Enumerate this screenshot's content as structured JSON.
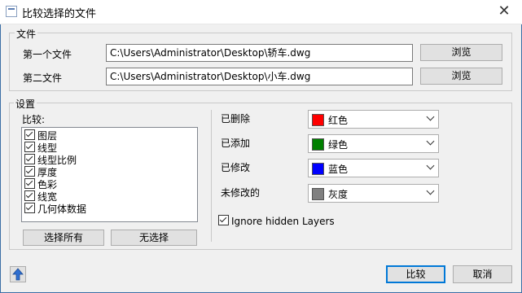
{
  "window": {
    "title": "比较选择的文件",
    "close_glyph": "✕"
  },
  "files": {
    "group_label": "文件",
    "first": {
      "label": "第一个文件",
      "value": "C:\\Users\\Administrator\\Desktop\\轿车.dwg",
      "browse_label": "浏览"
    },
    "second": {
      "label": "第二文件",
      "value": "C:\\Users\\Administrator\\Desktop\\小车.dwg",
      "browse_label": "浏览"
    }
  },
  "settings": {
    "group_label": "设置",
    "compare_label": "比较:",
    "compare_items": [
      {
        "label": "图层",
        "checked": true
      },
      {
        "label": "线型",
        "checked": true
      },
      {
        "label": "线型比例",
        "checked": true
      },
      {
        "label": "厚度",
        "checked": true
      },
      {
        "label": "色彩",
        "checked": true
      },
      {
        "label": "线宽",
        "checked": true
      },
      {
        "label": "几何体数据",
        "checked": true
      }
    ],
    "select_all_label": "选择所有",
    "select_none_label": "无选择",
    "colors": {
      "deleted": {
        "label": "已删除",
        "value": "红色",
        "swatch": "#ff0000"
      },
      "added": {
        "label": "已添加",
        "value": "绿色",
        "swatch": "#008000"
      },
      "modified": {
        "label": "已修改",
        "value": "蓝色",
        "swatch": "#0000ff"
      },
      "unmodified": {
        "label": "未修改的",
        "value": "灰度",
        "swatch": "#808080"
      }
    },
    "ignore_hidden": {
      "label": "Ignore hidden Layers",
      "checked": true
    }
  },
  "footer": {
    "up_icon": "arrow-up-icon",
    "compare_label": "比较",
    "cancel_label": "取消"
  }
}
